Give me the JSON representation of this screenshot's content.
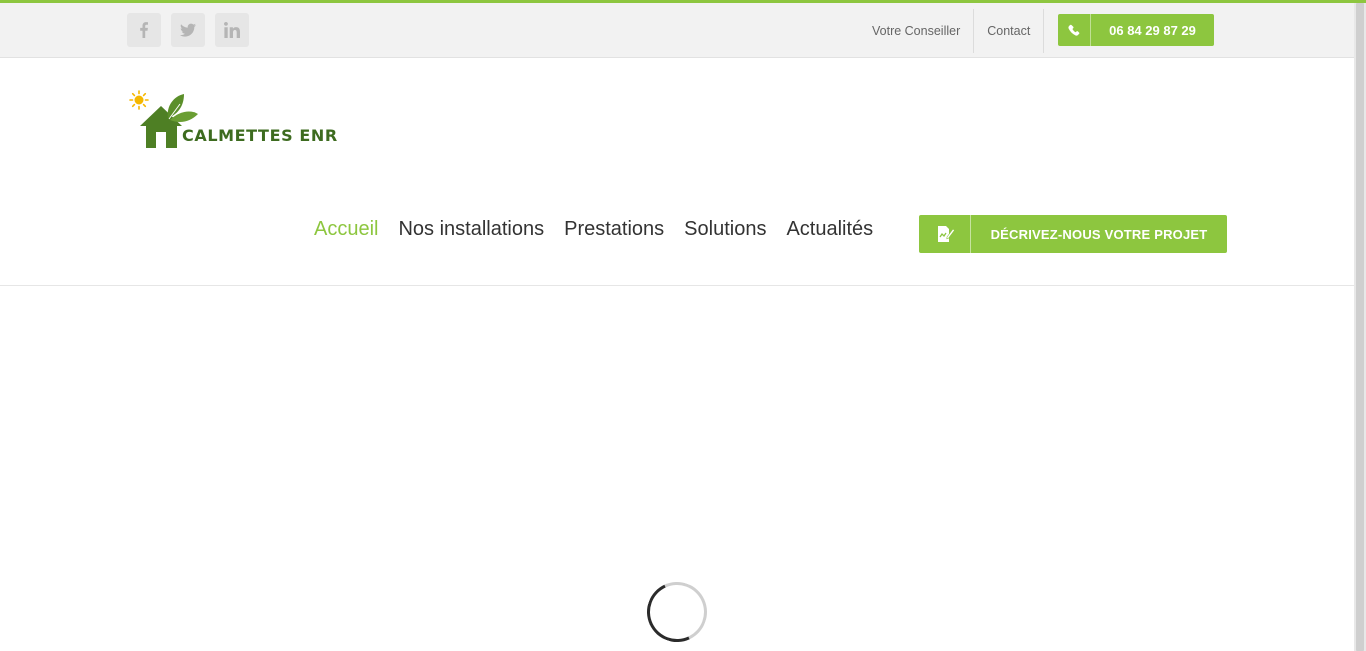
{
  "topbar": {
    "social": [
      {
        "icon": "facebook-icon",
        "glyph": "f"
      },
      {
        "icon": "twitter-icon"
      },
      {
        "icon": "linkedin-icon",
        "glyph": "in"
      }
    ],
    "links": [
      "Votre Conseiller",
      "Contact"
    ],
    "phone": "06 84 29 87 29"
  },
  "logo": {
    "text": "CALMETTES ENR"
  },
  "nav": {
    "items": [
      "Accueil",
      "Nos installations",
      "Prestations",
      "Solutions",
      "Actualités"
    ],
    "active_index": 0
  },
  "cta": {
    "label": "DÉCRIVEZ-NOUS VOTRE PROJET",
    "icon": "document-edit-icon"
  },
  "colors": {
    "accent": "#8dc63f",
    "logo_green": "#3d6b1f",
    "sun": "#f5b700"
  }
}
